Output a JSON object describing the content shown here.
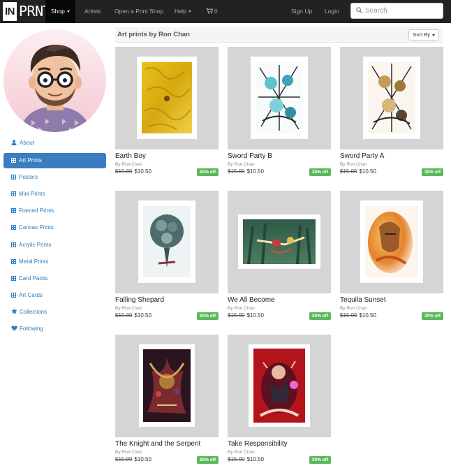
{
  "brand": {
    "logo_in": "IN",
    "logo_prnt": "PRNT"
  },
  "nav": {
    "shop": "Shop",
    "artists": "Artists",
    "open_shop": "Open a Print Shop",
    "help": "Help",
    "cart_count": "0",
    "signup": "Sign Up",
    "login": "Login",
    "search_placeholder": "Search"
  },
  "sidebar": {
    "items": [
      {
        "label": "About",
        "icon": "user-icon"
      },
      {
        "label": "Art Prints",
        "icon": "grid-icon"
      },
      {
        "label": "Posters",
        "icon": "grid-icon"
      },
      {
        "label": "Mini Prints",
        "icon": "grid-icon"
      },
      {
        "label": "Framed Prints",
        "icon": "grid-icon"
      },
      {
        "label": "Canvas Prints",
        "icon": "grid-icon"
      },
      {
        "label": "Acrylic Prints",
        "icon": "grid-icon"
      },
      {
        "label": "Metal Prints",
        "icon": "grid-icon"
      },
      {
        "label": "Card Packs",
        "icon": "grid-icon"
      },
      {
        "label": "Art Cards",
        "icon": "grid-icon"
      },
      {
        "label": "Collections",
        "icon": "star-icon"
      },
      {
        "label": "Following",
        "icon": "heart-icon"
      }
    ]
  },
  "header": {
    "title": "Art prints by Ron Chan",
    "sort_label": "Sort By"
  },
  "products": [
    {
      "title": "Earth Boy",
      "by": "By Ron Chan",
      "old_price": "$15.00",
      "price": "$10.50",
      "badge": "30% off"
    },
    {
      "title": "Sword Party B",
      "by": "By Ron Chan",
      "old_price": "$15.00",
      "price": "$10.50",
      "badge": "30% off"
    },
    {
      "title": "Sword Party A",
      "by": "By Ron Chan",
      "old_price": "$15.00",
      "price": "$10.50",
      "badge": "30% off"
    },
    {
      "title": "Falling Shepard",
      "by": "By Ron Chan",
      "old_price": "$15.00",
      "price": "$10.50",
      "badge": "30% off"
    },
    {
      "title": "We All Become",
      "by": "By Ron Chan",
      "old_price": "$15.00",
      "price": "$10.50",
      "badge": "30% off"
    },
    {
      "title": "Tequila Sunset",
      "by": "By Ron Chan",
      "old_price": "$15.00",
      "price": "$10.50",
      "badge": "30% off"
    },
    {
      "title": "The Knight and the Serpent",
      "by": "By Ron Chan",
      "old_price": "$15.00",
      "price": "$10.50",
      "badge": "30% off"
    },
    {
      "title": "Take Responsibility",
      "by": "By Ron Chan",
      "old_price": "$15.00",
      "price": "$10.50",
      "badge": "30% off"
    }
  ],
  "colors": {
    "nav_bg": "#222222",
    "accent": "#3a7ebf",
    "link": "#2a7cc0",
    "badge": "#5cb85c",
    "thumb_bg": "#d5d5d5"
  }
}
